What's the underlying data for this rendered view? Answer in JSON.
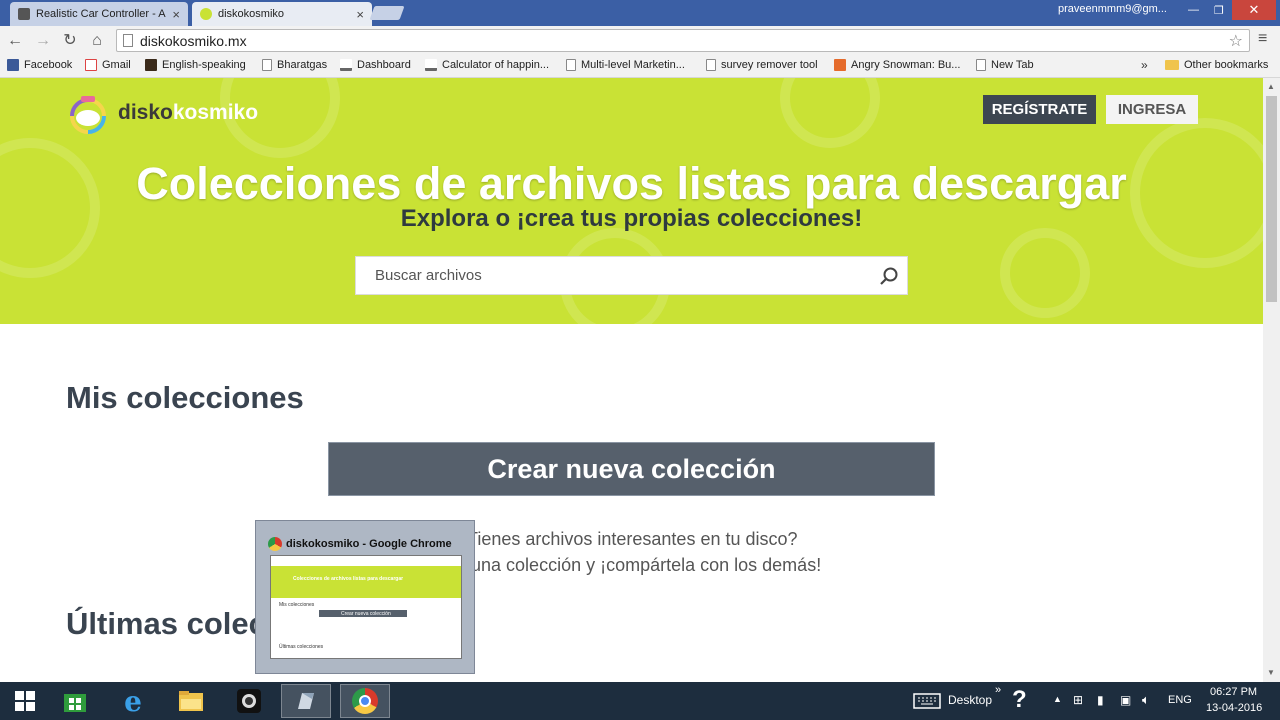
{
  "browser": {
    "tabs": [
      {
        "title": "Realistic Car Controller - A",
        "active": false
      },
      {
        "title": "diskokosmiko",
        "active": true
      }
    ],
    "user": "praveenmmm9@gm...",
    "url": "diskokosmiko.mx",
    "bookmarks": [
      {
        "label": "Facebook",
        "icon": "facebook-icon"
      },
      {
        "label": "Gmail",
        "icon": "gmail-icon"
      },
      {
        "label": "English-speaking",
        "icon": "app-icon"
      },
      {
        "label": "Bharatgas",
        "icon": "page-icon"
      },
      {
        "label": "Dashboard",
        "icon": "analytics-icon"
      },
      {
        "label": "Calculator of happin...",
        "icon": "analytics-icon"
      },
      {
        "label": "Multi-level Marketin...",
        "icon": "page-icon"
      },
      {
        "label": "survey remover tool",
        "icon": "page-icon"
      },
      {
        "label": "Angry Snowman: Bu...",
        "icon": "plus-icon"
      },
      {
        "label": "New Tab",
        "icon": "page-icon"
      }
    ],
    "bookmarks_more": "»",
    "other_bookmarks": "Other bookmarks"
  },
  "site": {
    "logo_bold": "disko",
    "logo_light": "kosmiko",
    "register_label": "REGÍSTRATE",
    "login_label": "INGRESA",
    "hero_title": "Colecciones de archivos listas para descargar",
    "hero_subtitle": "Explora o ¡crea tus propias colecciones!",
    "search_placeholder": "Buscar archivos",
    "my_collections_title": "Mis colecciones",
    "create_button_label": "Crear nueva colección",
    "info_line_1": "¿Tienes archivos interesantes en tu disco?",
    "info_line_2": "Crea una colección y ¡compártela con los demás!",
    "latest_collections_title": "Últimas colecciones",
    "colors": {
      "hero": "#c9e235",
      "dark_button": "#3d4651",
      "create_button": "#56606c"
    }
  },
  "preview": {
    "title": "diskokosmiko - Google Chrome",
    "mini_title": "Colecciones de archivos listas para descargar",
    "mini_my": "Mis colecciones",
    "mini_btn": "Crear nueva colección",
    "mini_latest": "Últimas colecciones"
  },
  "taskbar": {
    "apps": [
      "windows-start-icon",
      "store-icon",
      "internet-explorer-icon",
      "file-explorer-icon",
      "webcam-icon",
      "app-icon",
      "chrome-icon"
    ],
    "desktop_label": "Desktop",
    "language": "ENG",
    "time": "06:27 PM",
    "date": "13-04-2016"
  }
}
